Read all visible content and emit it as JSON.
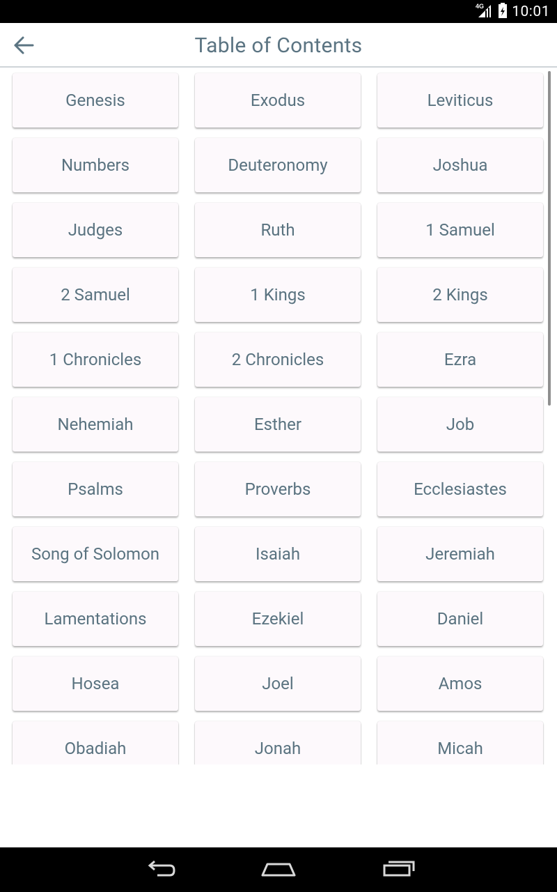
{
  "status_bar": {
    "network_label": "4G",
    "time": "10:01"
  },
  "app_bar": {
    "title": "Table of Contents",
    "back_icon": "arrow-left-icon"
  },
  "books": [
    "Genesis",
    "Exodus",
    "Leviticus",
    "Numbers",
    "Deuteronomy",
    "Joshua",
    "Judges",
    "Ruth",
    "1 Samuel",
    "2 Samuel",
    "1 Kings",
    "2 Kings",
    "1 Chronicles",
    "2 Chronicles",
    "Ezra",
    "Nehemiah",
    "Esther",
    "Job",
    "Psalms",
    "Proverbs",
    "Ecclesiastes",
    "Song of Solomon",
    "Isaiah",
    "Jeremiah",
    "Lamentations",
    "Ezekiel",
    "Daniel",
    "Hosea",
    "Joel",
    "Amos",
    "Obadiah",
    "Jonah",
    "Micah"
  ],
  "nav_bar": {
    "back_icon": "nav-back-icon",
    "home_icon": "nav-home-icon",
    "recents_icon": "nav-recents-icon"
  },
  "colors": {
    "title_text": "#5b7482",
    "button_text": "#5a7380",
    "button_bg": "#fdf9fc"
  }
}
